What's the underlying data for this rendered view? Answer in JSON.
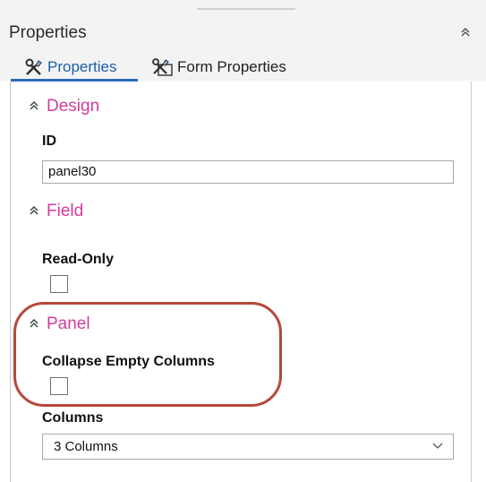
{
  "panel": {
    "title": "Properties"
  },
  "tabs": [
    {
      "label": "Properties",
      "icon": "tools-icon",
      "active": true
    },
    {
      "label": "Form Properties",
      "icon": "form-tools-icon",
      "active": false
    }
  ],
  "sections": {
    "design": {
      "title": "Design",
      "id_label": "ID",
      "id_value": "panel30"
    },
    "field": {
      "title": "Field",
      "readonly_label": "Read-Only",
      "readonly_checked": false
    },
    "panel": {
      "title": "Panel",
      "collapse_label": "Collapse Empty Columns",
      "collapse_checked": false,
      "columns_label": "Columns",
      "columns_value": "3 Columns"
    }
  },
  "colors": {
    "section_title": "#d23c9c",
    "active_tab": "#1e5fa8",
    "highlight": "#b5493a"
  }
}
